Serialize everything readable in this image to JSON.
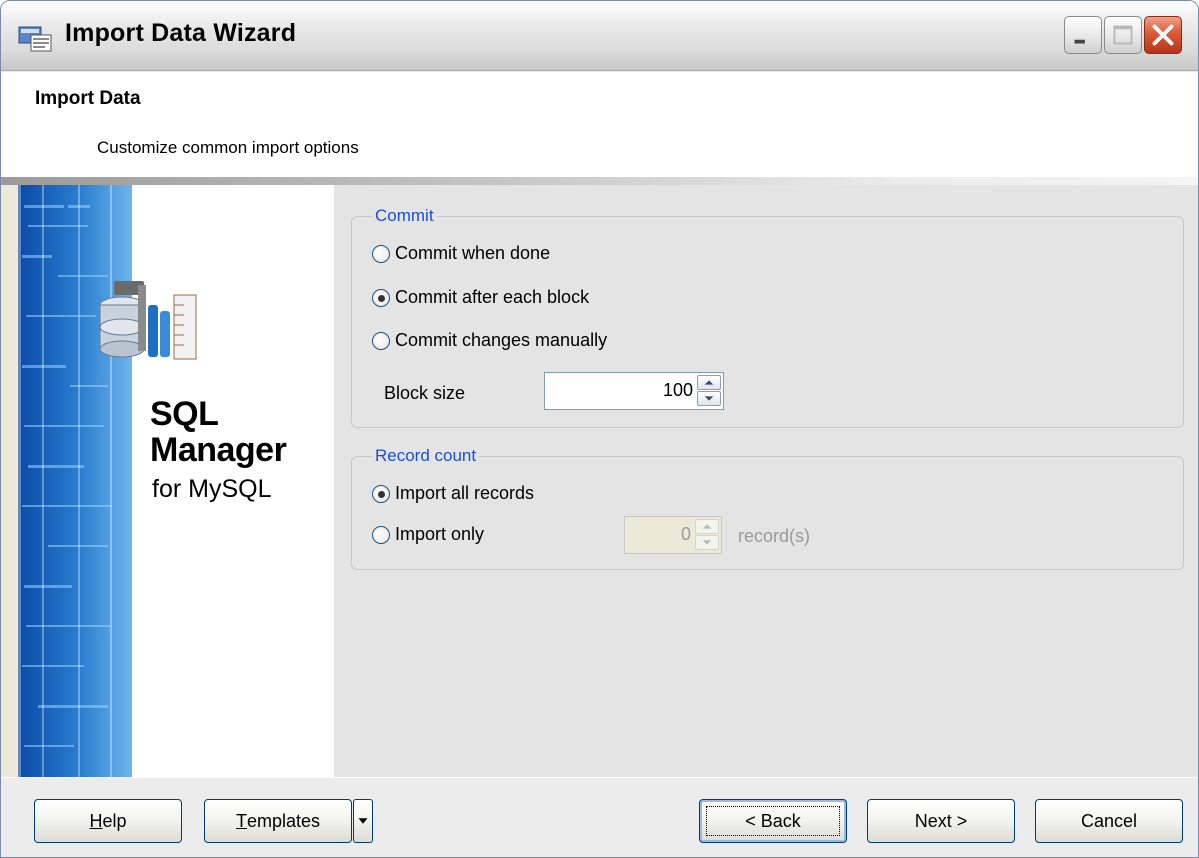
{
  "window": {
    "title": "Import Data Wizard"
  },
  "header": {
    "title": "Import Data",
    "subtitle": "Customize common import options"
  },
  "banner": {
    "line1": "SQL",
    "line2": "Manager",
    "line3": "for MySQL"
  },
  "commit_group": {
    "legend": "Commit",
    "options": [
      {
        "label": "Commit when done",
        "checked": false
      },
      {
        "label": "Commit after each block",
        "checked": true
      },
      {
        "label": "Commit changes manually",
        "checked": false
      }
    ],
    "block_size_label": "Block size",
    "block_size_value": "100"
  },
  "record_group": {
    "legend": "Record count",
    "options": [
      {
        "label": "Import all records",
        "checked": true
      },
      {
        "label": "Import only",
        "checked": false
      }
    ],
    "import_only_value": "0",
    "records_suffix": "record(s)"
  },
  "footer": {
    "help_label": "Help",
    "help_underline": "H",
    "templates_label": "Templates",
    "templates_underline": "T",
    "back_label": "< Back",
    "next_label": "Next >",
    "cancel_label": "Cancel"
  },
  "colors": {
    "legend_blue": "#1a4fd0",
    "content_bg": "#e4e4e4",
    "close_red": "#d85a3a"
  },
  "icons": [
    "app-icon",
    "minimize-icon",
    "maximize-icon",
    "close-icon",
    "dropdown-arrow-icon",
    "spin-up-icon",
    "spin-down-icon",
    "database-tools-icon"
  ]
}
